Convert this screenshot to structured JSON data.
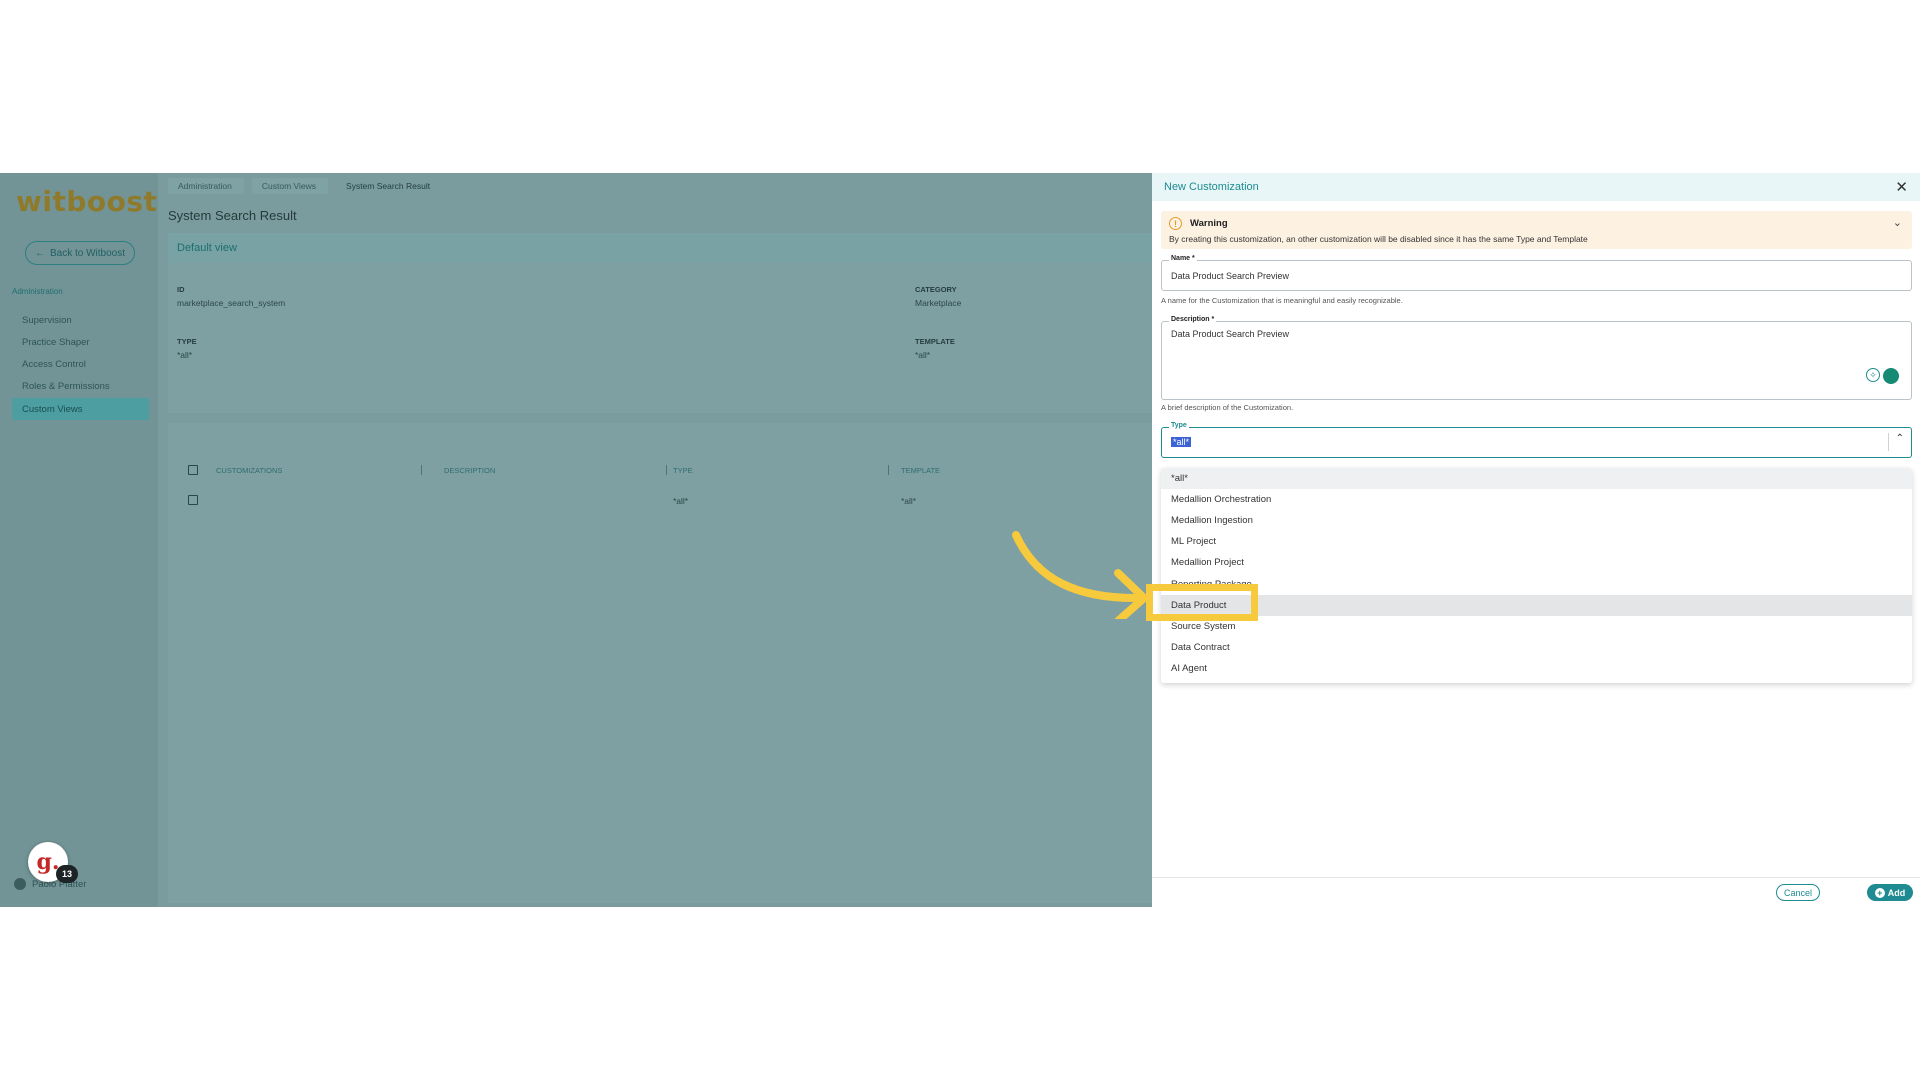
{
  "app": {
    "logo": "witboost",
    "back_label": "Back to Witboost",
    "section_title": "Administration",
    "nav_items": [
      "Supervision",
      "Practice Shaper",
      "Access Control",
      "Roles & Permissions",
      "Custom Views"
    ],
    "user_name": "Paolo Platter",
    "badge_letter": "g.",
    "badge_count": "13"
  },
  "main": {
    "breadcrumbs": [
      "Administration",
      "Custom Views",
      "System Search Result"
    ],
    "page_title": "System Search Result",
    "card_title": "Default view",
    "id_label": "ID",
    "id_value": "marketplace_search_system",
    "category_label": "CATEGORY",
    "category_value": "Marketplace",
    "type_label": "TYPE",
    "type_value": "*all*",
    "template_label": "TEMPLATE",
    "template_value": "*all*",
    "table": {
      "headers": [
        "CUSTOMIZATIONS",
        "DESCRIPTION",
        "TYPE",
        "TEMPLATE"
      ],
      "row": [
        "",
        "",
        "*all*",
        "*all*"
      ]
    }
  },
  "panel": {
    "title": "New Customization",
    "warning_title": "Warning",
    "warning_text": "By creating this customization, an other customization will be disabled since it has the same Type and Template",
    "name_label": "Name *",
    "name_value": "Data Product Search Preview",
    "name_helper": "A name for the Customization that is meaningful and easily recognizable.",
    "description_label": "Description *",
    "description_value": "Data Product Search Preview",
    "description_helper": "A brief description of the Customization.",
    "type_label": "Type",
    "type_value": "*all*",
    "type_options": [
      "*all*",
      "Medallion Orchestration",
      "Medallion Ingestion",
      "ML Project",
      "Medallion Project",
      "Reporting Package",
      "Data Product",
      "Source System",
      "Data Contract",
      "AI Agent"
    ],
    "cancel_label": "Cancel",
    "add_label": "Add"
  },
  "colors": {
    "accent": "#1d8b91",
    "highlight": "#f7c93c",
    "warning_bg": "#fdf1e2"
  }
}
